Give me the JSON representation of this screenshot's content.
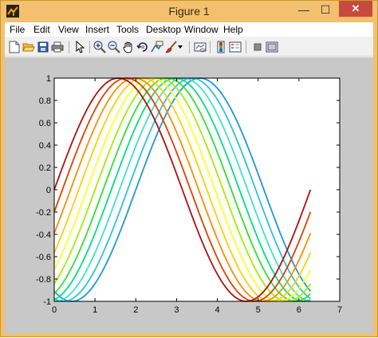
{
  "window": {
    "title": "Figure 1",
    "close_glyph": "✕",
    "minimize_glyph": "—",
    "maximize_glyph": "☐"
  },
  "menu": [
    "File",
    "Edit",
    "View",
    "Insert",
    "Tools",
    "Desktop",
    "Window",
    "Help"
  ],
  "toolbar": {
    "icons": [
      "new-figure-icon",
      "open-file-icon",
      "save-icon",
      "print-icon",
      "pointer-icon",
      "zoom-in-icon",
      "zoom-out-icon",
      "pan-icon",
      "rotate-icon",
      "data-cursor-icon",
      "brush-icon",
      "brush-dropdown-icon",
      "link-plot-icon",
      "colorbar-icon",
      "legend-icon",
      "hide-plot-tools-icon",
      "show-plot-tools-icon"
    ]
  },
  "chart_data": {
    "type": "line",
    "title": "",
    "xlabel": "",
    "ylabel": "",
    "xlim": [
      0,
      7
    ],
    "ylim": [
      -1,
      1
    ],
    "xticks": [
      "0",
      "1",
      "2",
      "3",
      "4",
      "5",
      "6",
      "7"
    ],
    "yticks": [
      "1",
      "0.8",
      "0.6",
      "0.4",
      "0.2",
      "0",
      "-0.2",
      "-0.4",
      "-0.6",
      "-0.8",
      "-1"
    ],
    "x_range": [
      0,
      6.2832
    ],
    "function": "sin(x + phase)",
    "grid": false,
    "legend": "none",
    "series_colors": [
      "#1b9ad4",
      "#2bc4d8",
      "#3fe0d0",
      "#00e080",
      "#30e030",
      "#a0f000",
      "#ffff20",
      "#ffd000",
      "#ff8c00",
      "#e04000",
      "#b01010"
    ],
    "phases": [
      -2.0,
      -1.8,
      -1.6,
      -1.4,
      -1.2,
      -1.0,
      -0.8,
      -0.6,
      -0.4,
      -0.2,
      0.0
    ]
  }
}
